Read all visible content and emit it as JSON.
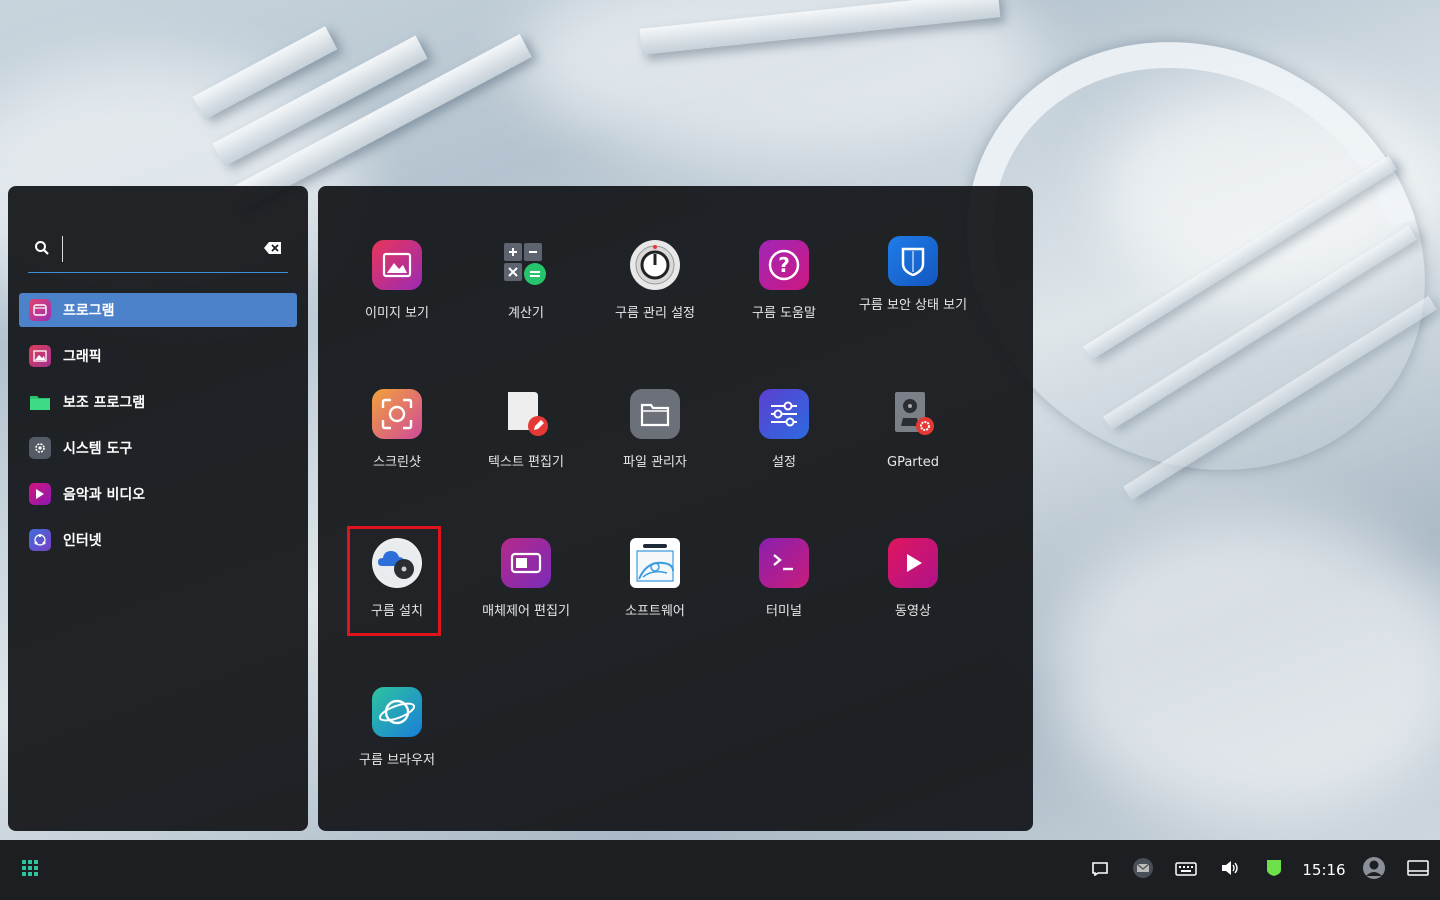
{
  "search": {
    "placeholder": "",
    "value": ""
  },
  "categories": [
    {
      "label": "프로그램",
      "icon": "program-icon",
      "active": true
    },
    {
      "label": "그래픽",
      "icon": "graphics-icon",
      "active": false
    },
    {
      "label": "보조 프로그램",
      "icon": "folder-icon",
      "active": false
    },
    {
      "label": "시스템 도구",
      "icon": "gear-icon",
      "active": false
    },
    {
      "label": "음악과 비디오",
      "icon": "play-icon",
      "active": false
    },
    {
      "label": "인터넷",
      "icon": "network-icon",
      "active": false
    }
  ],
  "apps": [
    {
      "label": "이미지 보기",
      "icon": "image-viewer-icon"
    },
    {
      "label": "계산기",
      "icon": "calculator-icon"
    },
    {
      "label": "구름 관리 설정",
      "icon": "control-knob-icon"
    },
    {
      "label": "구름 도움말",
      "icon": "help-icon"
    },
    {
      "label": "구름 보안 상태 보기",
      "icon": "shield-icon"
    },
    {
      "label": "스크린샷",
      "icon": "screenshot-icon"
    },
    {
      "label": "텍스트 편집기",
      "icon": "text-editor-icon"
    },
    {
      "label": "파일 관리자",
      "icon": "file-manager-icon"
    },
    {
      "label": "설정",
      "icon": "sliders-icon"
    },
    {
      "label": "GParted",
      "icon": "disk-icon"
    },
    {
      "label": "구름 설치",
      "icon": "installer-icon",
      "highlighted": true
    },
    {
      "label": "매체제어 편집기",
      "icon": "media-control-icon"
    },
    {
      "label": "소프트웨어",
      "icon": "software-icon"
    },
    {
      "label": "터미널",
      "icon": "terminal-icon"
    },
    {
      "label": "동영상",
      "icon": "video-player-icon"
    },
    {
      "label": "구름 브라우저",
      "icon": "browser-icon"
    }
  ],
  "taskbar": {
    "clock": "15:16"
  },
  "colors": {
    "accent": "#4b82c9",
    "highlight": "#e0141c",
    "search_line": "#3f8fd6"
  }
}
